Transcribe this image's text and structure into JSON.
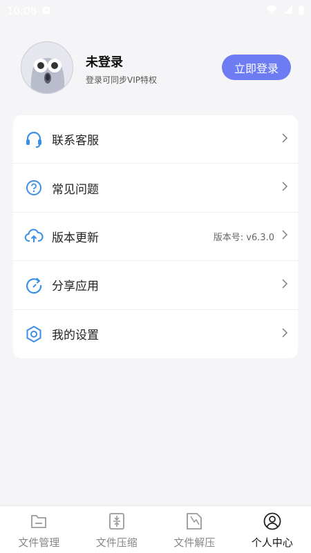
{
  "status_bar": {
    "time": "10:08"
  },
  "profile": {
    "name": "未登录",
    "subtitle": "登录可同步VIP特权",
    "login_button": "立即登录"
  },
  "menu": [
    {
      "label": "联系客服",
      "icon": "headset-icon"
    },
    {
      "label": "常见问题",
      "icon": "question-icon"
    },
    {
      "label": "版本更新",
      "icon": "cloud-upload-icon",
      "extra": "版本号: v6.3.0"
    },
    {
      "label": "分享应用",
      "icon": "share-refresh-icon"
    },
    {
      "label": "我的设置",
      "icon": "settings-hex-icon"
    }
  ],
  "tabs": [
    {
      "label": "文件管理",
      "icon": "folder-icon",
      "active": false
    },
    {
      "label": "文件压缩",
      "icon": "compress-icon",
      "active": false
    },
    {
      "label": "文件解压",
      "icon": "extract-icon",
      "active": false
    },
    {
      "label": "个人中心",
      "icon": "user-circle-icon",
      "active": true
    }
  ],
  "colors": {
    "accent": "#6d7cf2",
    "icon_blue": "#3a8ee6",
    "background": "#f5f5f7"
  }
}
